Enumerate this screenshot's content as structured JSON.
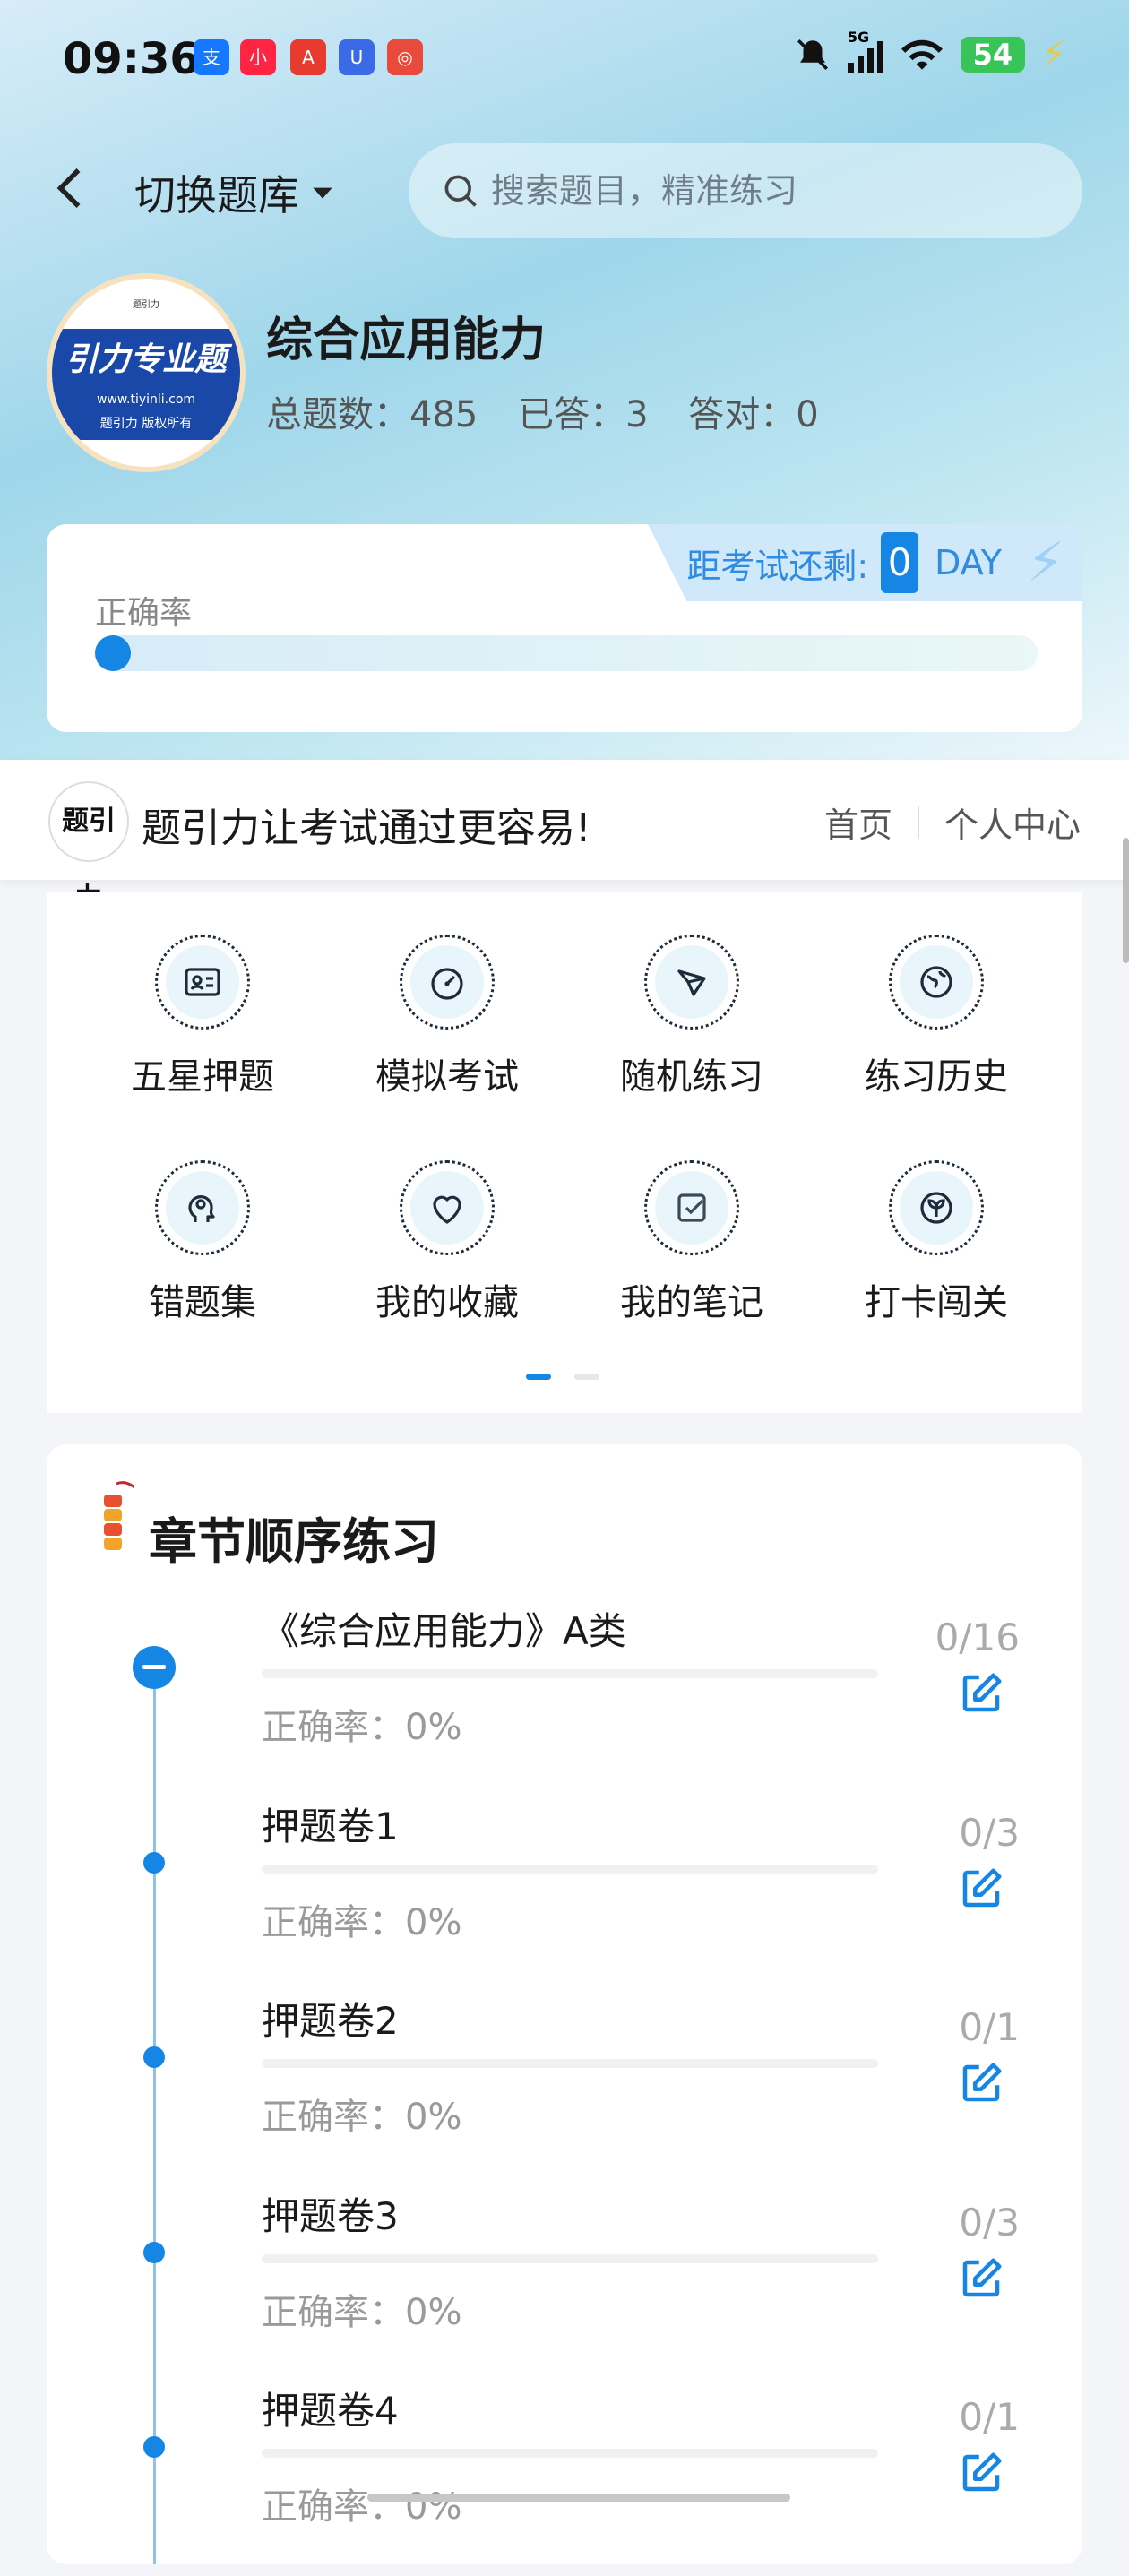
{
  "status_bar": {
    "time": "09:36",
    "app_icons": [
      {
        "name": "alipay-icon",
        "glyph": "支",
        "color": "#1677ff"
      },
      {
        "name": "xiaohongshu-icon",
        "glyph": "小",
        "color": "#ff2442"
      },
      {
        "name": "app-a-icon",
        "glyph": "A",
        "color": "#e63b2e"
      },
      {
        "name": "app-u-icon",
        "glyph": "U",
        "color": "#3a6ae5"
      },
      {
        "name": "app-game-icon",
        "glyph": "◎",
        "color": "#e84a3c"
      }
    ],
    "battery": "54",
    "network": "5G"
  },
  "nav": {
    "switch_label": "切换题库",
    "search_placeholder": "搜索题目，精准练习"
  },
  "profile": {
    "badge_text": "引力专业题",
    "badge_url": "www.tiyinli.com",
    "badge_copy": "题引力 版权所有",
    "badge_top": "题引力",
    "title": "综合应用能力",
    "total_label": "总题数：485",
    "answered_label": "已答：3",
    "correct_label": "答对：0"
  },
  "rate_card": {
    "countdown_label": "距考试还剩:",
    "countdown_days": "0",
    "countdown_unit": "DAY",
    "rate_label": "正确率",
    "rate_value": 0
  },
  "brand_bar": {
    "logo_text": "题引力",
    "slogan": "题引力让考试通过更容易!",
    "link_home": "首页",
    "link_profile": "个人中心"
  },
  "grid": {
    "items": [
      {
        "label": "五星押题",
        "icon": "id-card-icon"
      },
      {
        "label": "模拟考试",
        "icon": "gauge-icon"
      },
      {
        "label": "随机练习",
        "icon": "shuffle-icon"
      },
      {
        "label": "练习历史",
        "icon": "history-globe-icon"
      },
      {
        "label": "错题集",
        "icon": "brain-icon"
      },
      {
        "label": "我的收藏",
        "icon": "heart-icon"
      },
      {
        "label": "我的笔记",
        "icon": "checkbox-note-icon"
      },
      {
        "label": "打卡闯关",
        "icon": "sprout-icon"
      }
    ],
    "page_index": 1,
    "page_count": 2
  },
  "chapters": {
    "title": "章节顺序练习",
    "items": [
      {
        "name": "《综合应用能力》A类",
        "rate": "正确率：0%",
        "count": "0/16"
      },
      {
        "name": "押题卷1",
        "rate": "正确率：0%",
        "count": "0/3"
      },
      {
        "name": "押题卷2",
        "rate": "正确率：0%",
        "count": "0/1"
      },
      {
        "name": "押题卷3",
        "rate": "正确率：0%",
        "count": "0/3"
      },
      {
        "name": "押题卷4",
        "rate": "正确率：0%",
        "count": "0/1"
      }
    ]
  },
  "colors": {
    "accent": "#1686e5",
    "text": "#1a1a1a",
    "muted": "#9a9a9a"
  }
}
